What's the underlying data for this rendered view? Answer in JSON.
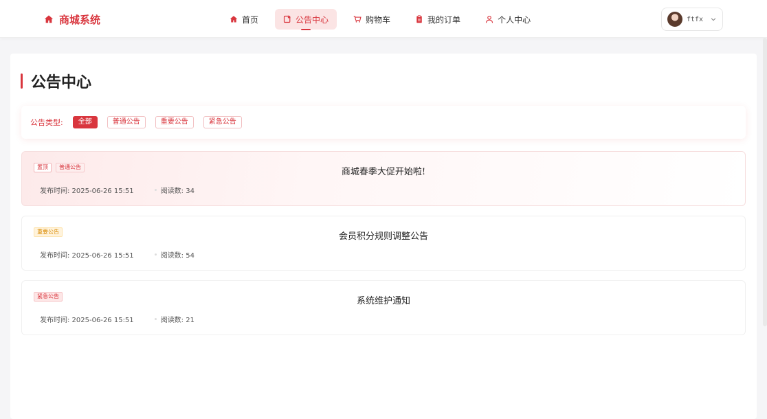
{
  "brand": {
    "title": "商城系统"
  },
  "nav": [
    {
      "label": "首页",
      "icon": "home-icon",
      "active": false
    },
    {
      "label": "公告中心",
      "icon": "notice-icon",
      "active": true
    },
    {
      "label": "购物车",
      "icon": "cart-icon",
      "active": false
    },
    {
      "label": "我的订单",
      "icon": "order-icon",
      "active": false
    },
    {
      "label": "个人中心",
      "icon": "user-icon",
      "active": false
    }
  ],
  "user": {
    "name": "ftfx"
  },
  "page": {
    "title": "公告中心"
  },
  "filter": {
    "label": "公告类型:",
    "options": [
      "全部",
      "普通公告",
      "重要公告",
      "紧急公告"
    ],
    "selected": "全部"
  },
  "notices": [
    {
      "pinned": true,
      "tags": [
        "置顶",
        "普通公告"
      ],
      "title": "商城春季大促开始啦!",
      "time_label": "发布时间: 2025-06-26 15:51",
      "views_label": "阅读数: 34"
    },
    {
      "pinned": false,
      "tags": [
        "重要公告"
      ],
      "title": "会员积分规则调整公告",
      "time_label": "发布时间: 2025-06-26 15:51",
      "views_label": "阅读数: 54"
    },
    {
      "pinned": false,
      "tags": [
        "紧急公告"
      ],
      "title": "系统维护通知",
      "time_label": "发布时间: 2025-06-26 15:51",
      "views_label": "阅读数: 21"
    }
  ],
  "colors": {
    "accent": "#d9363e",
    "accent_light": "#fbe4e4",
    "important": "#d98a00"
  }
}
